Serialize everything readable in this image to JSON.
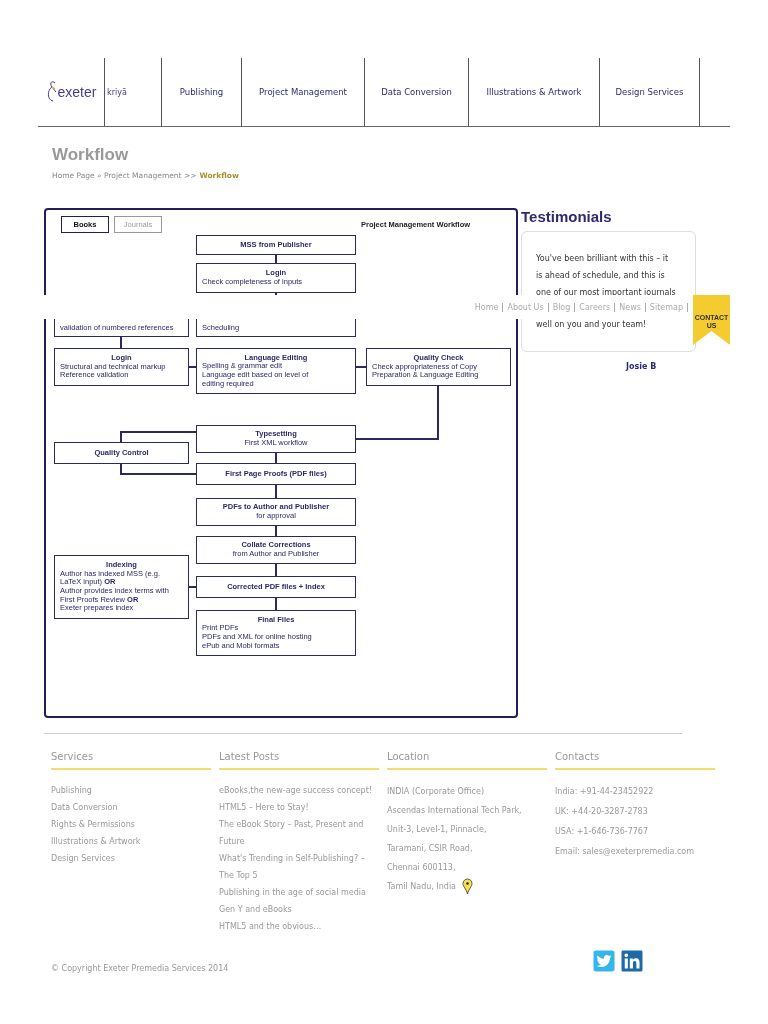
{
  "logo": {
    "name": "exeter",
    "product": "kriyā"
  },
  "nav": [
    {
      "label": "Publishing"
    },
    {
      "label": "Project Management"
    },
    {
      "label": "Data Conversion"
    },
    {
      "label": "Illustrations & Artwork"
    },
    {
      "label": "Design Services"
    }
  ],
  "page_title": "Workflow",
  "breadcrumb": {
    "trail": "Home Page » Project Management >>",
    "current": "Workflow"
  },
  "diagram": {
    "title": "Project Management Workflow",
    "tabs": [
      {
        "label": "Books",
        "selected": true
      },
      {
        "label": "Journals",
        "selected": false
      }
    ],
    "nodes": [
      {
        "title": "MSS from Publisher",
        "kind": "step"
      },
      {
        "title": "Login",
        "body": [
          "Check completeness of inputs"
        ],
        "kind": "detail"
      },
      {
        "body": [
          "validation of numbered references"
        ],
        "kind": "detail"
      },
      {
        "body": [
          "Scheduling"
        ],
        "kind": "detail"
      },
      {
        "title": "Login",
        "body": [
          "Structural and technical markup",
          "Reference validation"
        ],
        "kind": "detail"
      },
      {
        "title": "Language Editing",
        "body": [
          "Spelling & grammar edit",
          "Language edit based on level of",
          "editing required"
        ],
        "kind": "detail"
      },
      {
        "title": "Quality Check",
        "body": [
          "Check appropriateness of Copy",
          "Preparation & Language Editing"
        ],
        "kind": "detail"
      },
      {
        "title": "Typesetting",
        "body": [
          "First XML workflow"
        ],
        "kind": "step"
      },
      {
        "title": "Quality Control",
        "kind": "step"
      },
      {
        "title": "First Page Proofs (PDF files)",
        "kind": "step"
      },
      {
        "title": "PDFs to Author and Publisher",
        "body": [
          "for approval"
        ],
        "kind": "step"
      },
      {
        "title": "Collate Corrections",
        "body": [
          "from Author and Publisher"
        ],
        "kind": "step"
      },
      {
        "title": "Indexing",
        "body": [
          "Author has indexed MSS (e.g.",
          "LaTeX input) **OR**",
          "Author provides index terms with",
          "First Proofs Review **OR**",
          "Exeter prepares index"
        ],
        "kind": "detail"
      },
      {
        "title": "Corrected PDF files + Index",
        "kind": "step"
      },
      {
        "title": "Final Files",
        "body": [
          "Print PDFs",
          "PDFs and XML for online hosting",
          "ePub and Mobi formats"
        ],
        "kind": "detail"
      }
    ]
  },
  "overlay_links": [
    "Home",
    "About Us",
    "Blog",
    "Careers",
    "News",
    "Sitemap"
  ],
  "contact_ribbon": "CONTACT US",
  "testimonials": {
    "heading": "Testimonials",
    "lines": [
      "You've been brilliant with this – it",
      "is ahead of schedule, and this is",
      "one of our most important journals",
      "well on you and your team!"
    ],
    "author": "Josie B"
  },
  "footer": {
    "columns": [
      {
        "heading": "Services",
        "kind": "links",
        "items": [
          "Publishing",
          "Data Conversion",
          "Rights & Permissions",
          "Illustrations & Artwork",
          "Design Services"
        ]
      },
      {
        "heading": "Latest Posts",
        "kind": "links",
        "items": [
          "eBooks,the new-age success concept!",
          "HTML5 – Here to Stay!",
          "The eBook Story – Past, Present and Future",
          "What's Trending in Self-Publishing? – The Top 5",
          "Publishing in the age of social media",
          "Gen Y and eBooks",
          "HTML5 and the obvious…"
        ]
      },
      {
        "heading": "Location",
        "kind": "address",
        "items": [
          "INDIA (Corporate Office)",
          "Ascendas International Tech Park,",
          "Unit-3, Level-1, Pinnacle,",
          "Taramani, CSIR Road,",
          "Chennai 600113,",
          "Tamil Nadu, India"
        ]
      },
      {
        "heading": "Contacts",
        "kind": "contacts",
        "items": [
          "India: +91-44-23452922",
          "UK: +44-20-3287-2783",
          "USA: +1-646-736-7767",
          "Email: sales@exeterpremedia.com"
        ]
      }
    ]
  },
  "copyright": "© Copyright Exeter Premedia Services 2014"
}
